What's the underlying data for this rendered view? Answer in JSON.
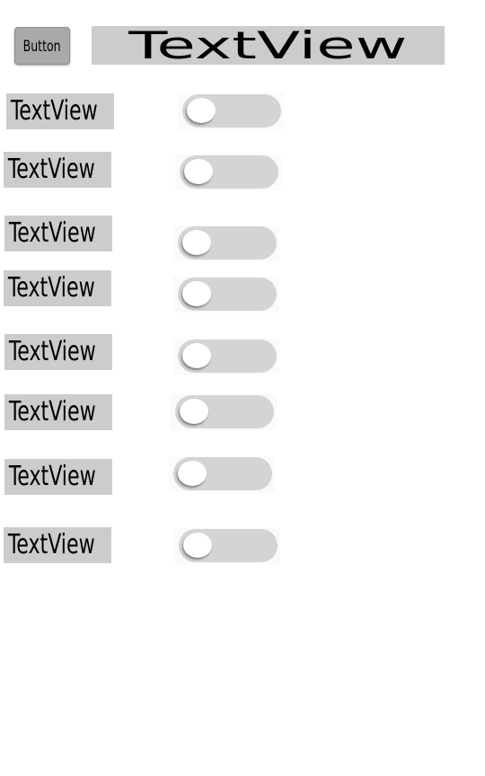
{
  "button": {
    "label": "Button"
  },
  "title": {
    "text": "TextView"
  },
  "rows": [
    {
      "label": "TextView",
      "switch_on": false
    },
    {
      "label": "TextView",
      "switch_on": false
    },
    {
      "label": "TextView",
      "switch_on": false
    },
    {
      "label": "TextView",
      "switch_on": false
    },
    {
      "label": "TextView",
      "switch_on": false
    },
    {
      "label": "TextView",
      "switch_on": false
    },
    {
      "label": "TextView",
      "switch_on": false
    },
    {
      "label": "TextView",
      "switch_on": false
    }
  ],
  "colors": {
    "label_background": "#cccccc",
    "switch_track": "#d4d4d4",
    "switch_thumb": "#ffffff",
    "button_background": "#a9a9a9"
  }
}
